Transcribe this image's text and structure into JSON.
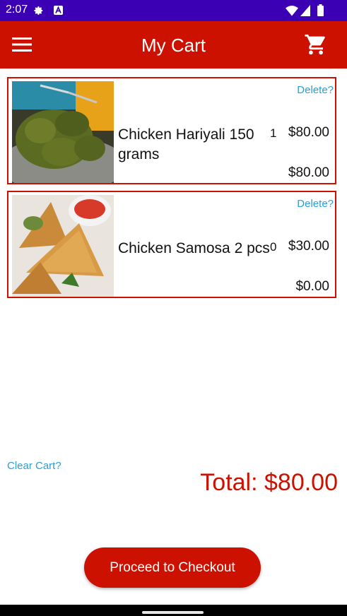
{
  "status_bar": {
    "time": "2:07"
  },
  "app_bar": {
    "title": "My Cart"
  },
  "items": [
    {
      "name": "Chicken Hariyali 150 grams",
      "quantity": "1",
      "price": "$80.00",
      "subtotal": "$80.00",
      "delete_label": "Delete?"
    },
    {
      "name": "Chicken Samosa 2 pcs",
      "quantity": "0",
      "price": "$30.00",
      "subtotal": "$0.00",
      "delete_label": "Delete?"
    }
  ],
  "clear_cart_label": "Clear Cart?",
  "total_label": "Total: $80.00",
  "checkout_label": "Proceed to Checkout",
  "colors": {
    "accent": "#cc1100",
    "status_bar": "#3c00b4",
    "link": "#2a9fd6"
  },
  "icons": [
    "settings-icon",
    "notification-a-icon",
    "wifi-icon",
    "signal-icon",
    "battery-icon",
    "menu-icon",
    "cart-icon"
  ]
}
